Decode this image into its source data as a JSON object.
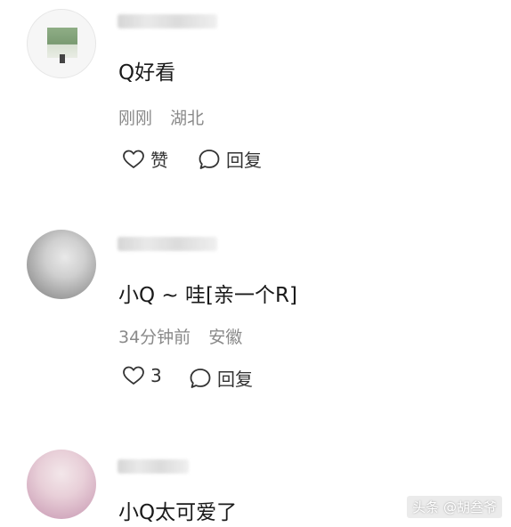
{
  "comments": [
    {
      "text": "Q好看",
      "time": "刚刚",
      "location": "湖北",
      "like_label": "赞",
      "reply_label": "回复"
    },
    {
      "text": "小Q ~ 哇[亲一个R]",
      "time": "34分钟前",
      "location": "安徽",
      "like_count": "3",
      "reply_label": "回复"
    },
    {
      "text": "小Q太可爱了"
    }
  ],
  "watermark": "头条 @胡叁爷",
  "icons": {
    "like": "heart-outline-icon",
    "reply": "speech-bubble-icon"
  },
  "colors": {
    "text": "#1a1a1a",
    "meta": "#8a8a8a",
    "icon": "#333333"
  }
}
